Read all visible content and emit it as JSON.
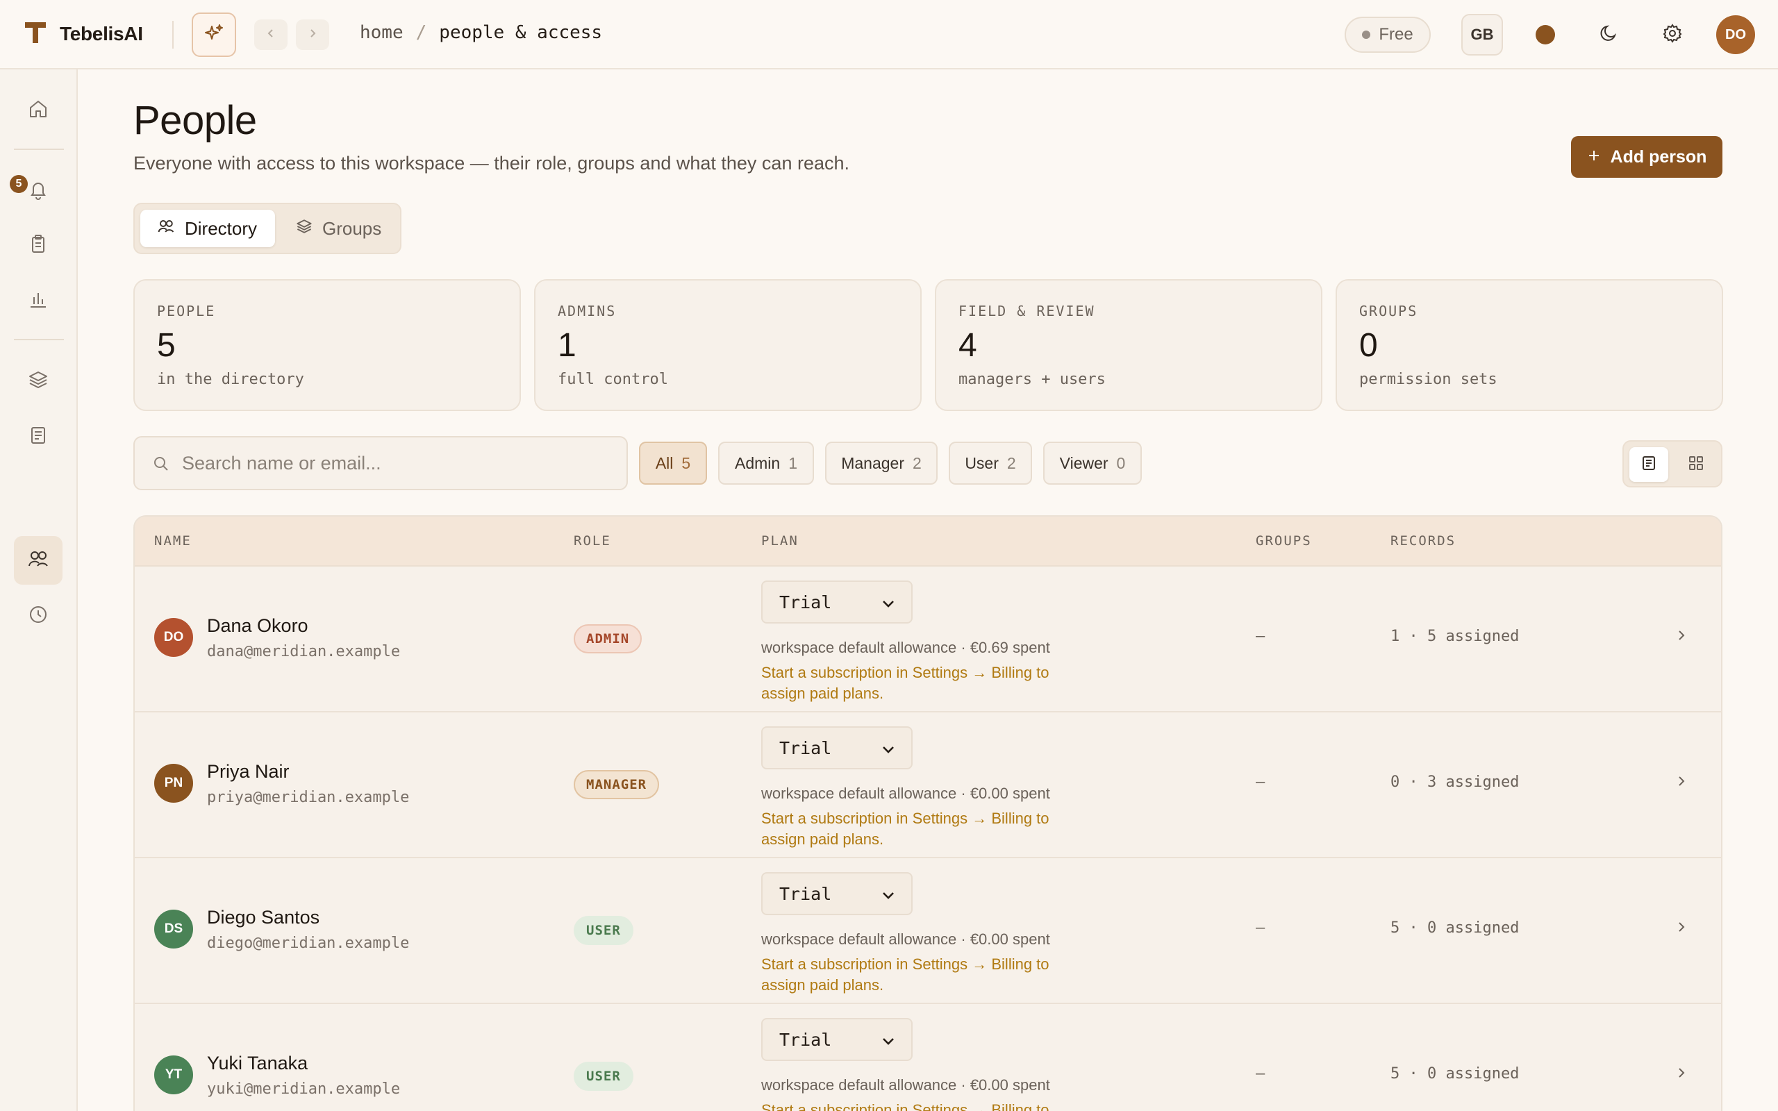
{
  "app": {
    "name": "TebelisAI"
  },
  "breadcrumb": {
    "home": "home",
    "sep": "/",
    "current": "people & access"
  },
  "topbar": {
    "plan": "Free",
    "language": "GB",
    "user_initials": "DO",
    "accent_color": "#8a531f"
  },
  "sidebar": {
    "notifications_badge": "5"
  },
  "page": {
    "title": "People",
    "subtitle": "Everyone with access to this workspace — their role, groups and what they can reach.",
    "add_button": "Add person"
  },
  "tabs": {
    "directory": "Directory",
    "groups": "Groups"
  },
  "stats": [
    {
      "label": "PEOPLE",
      "value": "5",
      "note": "in the directory"
    },
    {
      "label": "ADMINS",
      "value": "1",
      "note": "full control"
    },
    {
      "label": "FIELD & REVIEW",
      "value": "4",
      "note": "managers + users"
    },
    {
      "label": "GROUPS",
      "value": "0",
      "note": "permission sets"
    }
  ],
  "search": {
    "placeholder": "Search name or email..."
  },
  "filters": [
    {
      "label": "All",
      "count": "5"
    },
    {
      "label": "Admin",
      "count": "1"
    },
    {
      "label": "Manager",
      "count": "2"
    },
    {
      "label": "User",
      "count": "2"
    },
    {
      "label": "Viewer",
      "count": "0"
    }
  ],
  "table": {
    "headers": {
      "name": "NAME",
      "role": "ROLE",
      "plan": "PLAN",
      "groups": "GROUPS",
      "records": "RECORDS"
    },
    "rows": [
      {
        "initials": "DO",
        "avatar_color": "#b4512f",
        "name": "Dana Okoro",
        "email": "dana@meridian.example",
        "role": "ADMIN",
        "plan": "Trial",
        "allowance": "workspace default allowance · €0.69 spent",
        "warning": "Start a subscription in Settings → Billing to assign paid plans.",
        "groups": "–",
        "records": "1 · 5 assigned"
      },
      {
        "initials": "PN",
        "avatar_color": "#8a531f",
        "name": "Priya Nair",
        "email": "priya@meridian.example",
        "role": "MANAGER",
        "plan": "Trial",
        "allowance": "workspace default allowance · €0.00 spent",
        "warning": "Start a subscription in Settings → Billing to assign paid plans.",
        "groups": "–",
        "records": "0 · 3 assigned"
      },
      {
        "initials": "DS",
        "avatar_color": "#4a8356",
        "name": "Diego Santos",
        "email": "diego@meridian.example",
        "role": "USER",
        "plan": "Trial",
        "allowance": "workspace default allowance · €0.00 spent",
        "warning": "Start a subscription in Settings → Billing to assign paid plans.",
        "groups": "–",
        "records": "5 · 0 assigned"
      },
      {
        "initials": "YT",
        "avatar_color": "#4a8356",
        "name": "Yuki Tanaka",
        "email": "yuki@meridian.example",
        "role": "USER",
        "plan": "Trial",
        "allowance": "workspace default allowance · €0.00 spent",
        "warning": "Start a subscription in Settings → Billing to assign paid plans.",
        "groups": "–",
        "records": "5 · 0 assigned"
      }
    ]
  }
}
